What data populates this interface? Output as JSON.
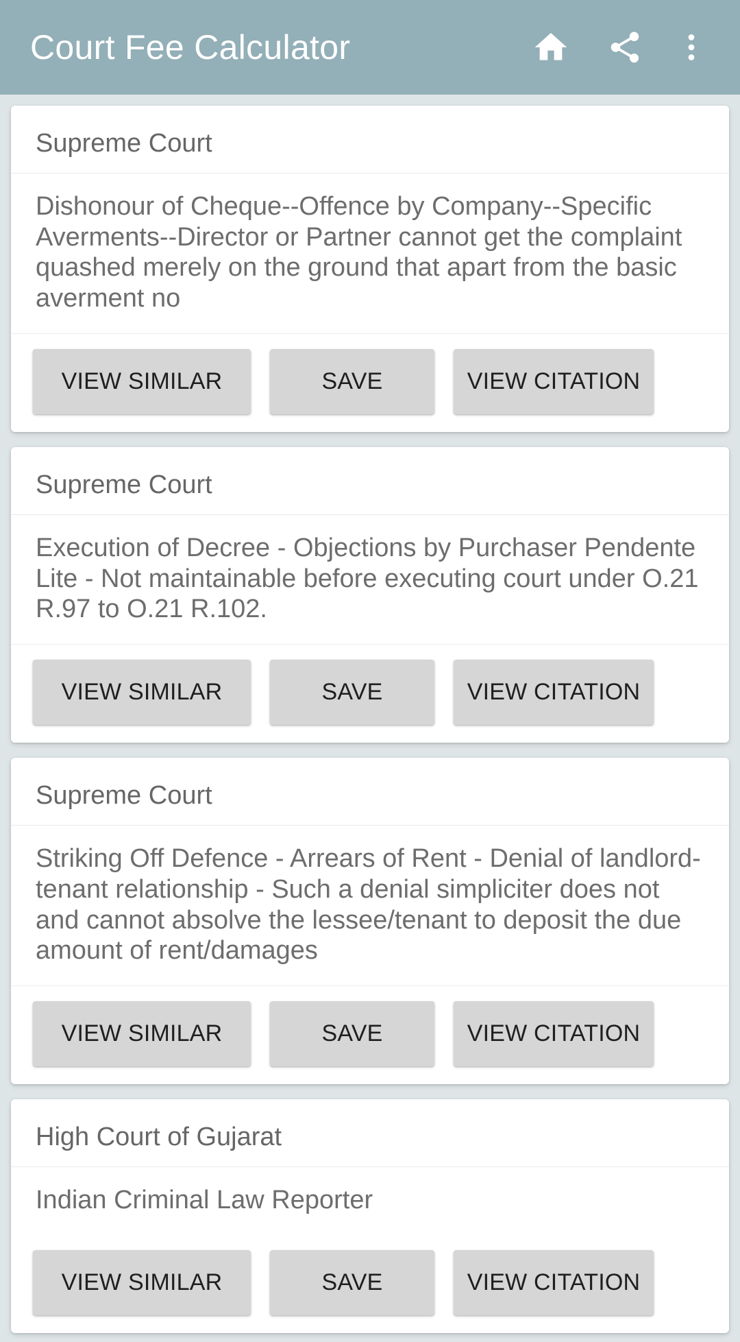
{
  "appbar": {
    "title": "Court Fee Calculator",
    "background_color": "#93afb8",
    "title_color": "#ffffff",
    "actions": [
      {
        "icon": "home-icon",
        "name": "home"
      },
      {
        "icon": "share-icon",
        "name": "share"
      },
      {
        "icon": "more-vert-icon",
        "name": "overflow-menu"
      }
    ]
  },
  "page": {
    "background_color": "#dee5e7",
    "card_background_color": "#ffffff",
    "button_background_color": "#d6d6d6"
  },
  "buttons": {
    "view_similar": "VIEW SIMILAR",
    "save": "SAVE",
    "view_citation": "VIEW CITATION"
  },
  "results": [
    {
      "court": "Supreme Court",
      "summary": "Dishonour of Cheque--Offence by Company--Specific Averments--Director or Partner cannot get the complaint quashed merely on the ground that apart from the basic averment no"
    },
    {
      "court": "Supreme Court",
      "summary": "Execution of Decree - Objections by Purchaser Pendente Lite - Not maintainable before executing court under O.21 R.97 to O.21 R.102."
    },
    {
      "court": "Supreme Court",
      "summary": "Striking Off Defence - Arrears of Rent - Denial of landlord-tenant relationship - Such a denial simpliciter does not and cannot absolve the lessee/tenant to deposit the due amount of rent/damages"
    },
    {
      "court": "High Court of Gujarat",
      "summary": "Indian Criminal Law Reporter"
    }
  ]
}
